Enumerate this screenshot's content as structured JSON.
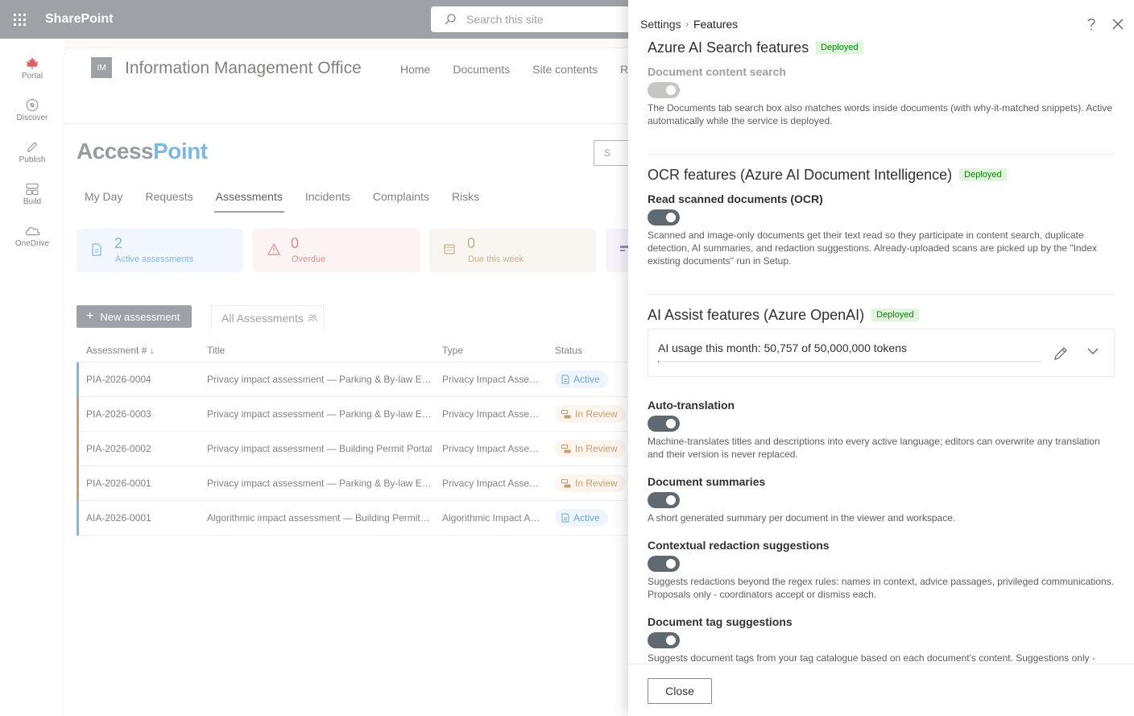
{
  "suite": {
    "title": "SharePoint",
    "search_placeholder": "Search this site"
  },
  "rail": [
    {
      "label": "Portal",
      "icon": "maple-leaf-icon"
    },
    {
      "label": "Discover",
      "icon": "compass-icon"
    },
    {
      "label": "Publish",
      "icon": "pen-icon"
    },
    {
      "label": "Build",
      "icon": "layout-icon"
    },
    {
      "label": "OneDrive",
      "icon": "cloud-icon"
    }
  ],
  "site": {
    "logo": "IM",
    "name": "Information Management Office",
    "nav": [
      "Home",
      "Documents",
      "Site contents",
      "Re"
    ],
    "brand_a": "Access",
    "brand_b": "Point",
    "search_stub": "S"
  },
  "tabs": [
    "My Day",
    "Requests",
    "Assessments",
    "Incidents",
    "Complaints",
    "Risks"
  ],
  "cards": [
    {
      "value": "2",
      "label": "Active assessments"
    },
    {
      "value": "0",
      "label": "Overdue"
    },
    {
      "value": "0",
      "label": "Due this week"
    }
  ],
  "toolbar": {
    "new_label": "New assessment",
    "view_label": "All Assessments"
  },
  "table": {
    "headers": [
      "Assessment #",
      "Title",
      "Type",
      "Status"
    ],
    "rows": [
      {
        "id": "PIA-2026-0004",
        "title": "Privacy impact assessment — Parking & By-law Enforcement",
        "type": "Privacy Impact Assessment",
        "status": "Active"
      },
      {
        "id": "PIA-2026-0003",
        "title": "Privacy impact assessment — Parking & By-law Enforcement",
        "type": "Privacy Impact Assessment",
        "status": "In Review"
      },
      {
        "id": "PIA-2026-0002",
        "title": "Privacy impact assessment — Building Permit Portal",
        "type": "Privacy Impact Assessment",
        "status": "In Review"
      },
      {
        "id": "PIA-2026-0001",
        "title": "Privacy impact assessment — Parking & By-law Enforcement",
        "type": "Privacy Impact Assessment",
        "status": "In Review"
      },
      {
        "id": "AIA-2026-0001",
        "title": "Algorithmic impact assessment — Building Permit Portal",
        "type": "Algorithmic Impact Assessment",
        "status": "Active"
      }
    ]
  },
  "panel": {
    "crumb_parent": "Settings",
    "crumb_current": "Features",
    "deployed_label": "Deployed",
    "search_section": {
      "title": "Azure AI Search features",
      "feature": "Document content search",
      "desc": "The Documents tab search box also matches words inside documents (with why-it-matched snippets). Active automatically while the service is deployed."
    },
    "ocr_section": {
      "title": "OCR features (Azure AI Document Intelligence)",
      "feature": "Read scanned documents (OCR)",
      "desc": "Scanned and image-only documents get their text read so they participate in content search, duplicate detection, AI summaries, and redaction suggestions. Already-uploaded scans are picked up by the \"Index existing documents\" run in Setup."
    },
    "ai_section": {
      "title": "AI Assist features (Azure OpenAI)",
      "usage_text": "AI usage this month: 50,757 of 50,000,000 tokens",
      "usage_fraction": 0.001,
      "features": [
        {
          "name": "Auto-translation",
          "desc": "Machine-translates titles and descriptions into every active language; editors can overwrite any translation and their version is never replaced."
        },
        {
          "name": "Document summaries",
          "desc": "A short generated summary per document in the viewer and workspace."
        },
        {
          "name": "Contextual redaction suggestions",
          "desc": "Suggests redactions beyond the regex rules: names in context, advice passages, privileged communications. Proposals only - coordinators accept or dismiss each."
        },
        {
          "name": "Document tag suggestions",
          "desc": "Suggests document tags from your tag catalogue based on each document's content. Suggestions only - coordinators accept or dismiss each."
        }
      ]
    },
    "close_label": "Close"
  }
}
